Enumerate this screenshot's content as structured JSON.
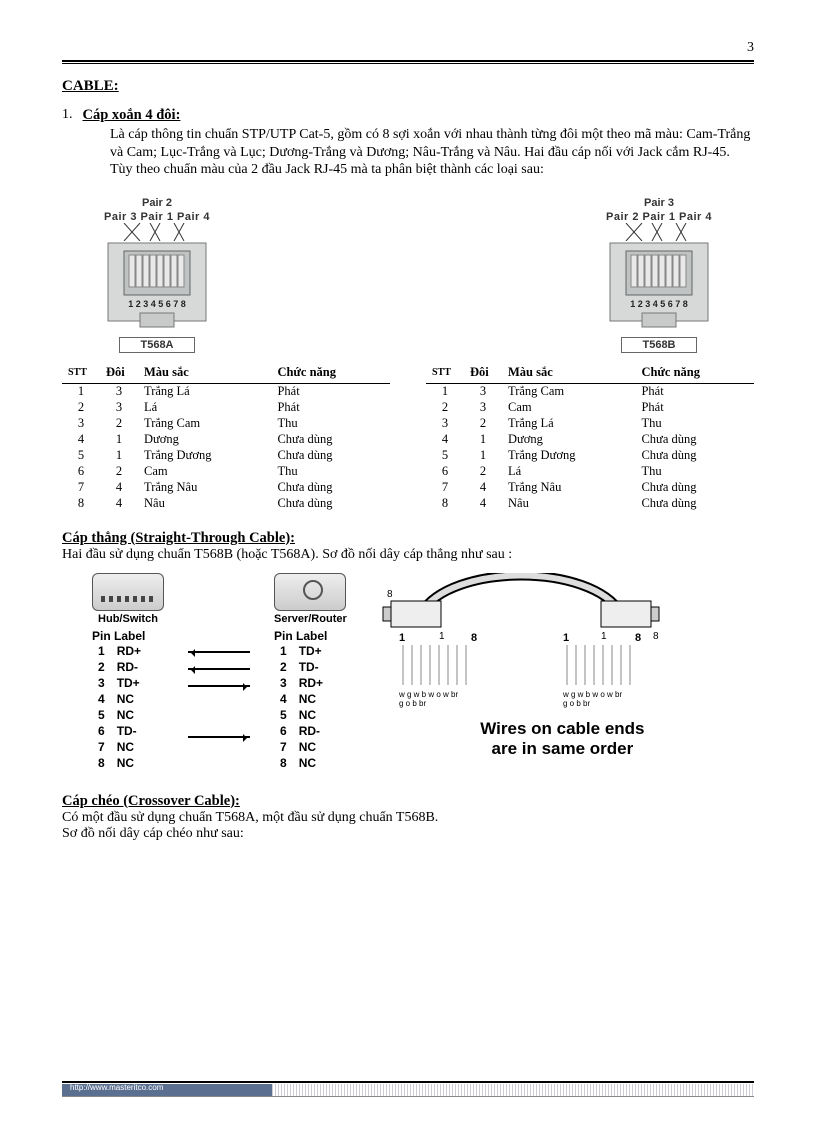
{
  "page_number": "3",
  "section_title": "CABLE:",
  "item1": {
    "num": "1.",
    "heading": "Cáp xoắn 4 đôi:",
    "para": "Là cáp thông tin chuẩn STP/UTP Cat-5, gồm có 8 sợi xoắn với nhau thành từng đôi một theo mã màu: Cam-Trắng và Cam; Lục-Trắng và Lục; Dương-Trắng và Dương; Nâu-Trắng và Nâu. Hai đầu cáp nối với Jack cắm RJ-45.\nTùy theo chuẩn màu của 2 đầu Jack RJ-45 mà ta phân biệt thành các loại sau:"
  },
  "jackA": {
    "top": "Pair 2",
    "mid": "Pair 3  Pair 1  Pair 4",
    "pins": "1 2 3 4 5 6 7 8",
    "label": "T568A"
  },
  "jackB": {
    "top": "Pair 3",
    "mid": "Pair 2  Pair 1  Pair 4",
    "pins": "1 2 3 4 5 6 7 8",
    "label": "T568B"
  },
  "tbl_headers": {
    "stt": "STT",
    "doi": "Đôi",
    "mau": "Màu sắc",
    "chuc": "Chức năng"
  },
  "left_rows": [
    {
      "stt": "1",
      "doi": "3",
      "mau": "Trắng Lá",
      "chuc": "Phát"
    },
    {
      "stt": "2",
      "doi": "3",
      "mau": "Lá",
      "chuc": "Phát"
    },
    {
      "stt": "3",
      "doi": "2",
      "mau": "Trắng Cam",
      "chuc": "Thu"
    },
    {
      "stt": "4",
      "doi": "1",
      "mau": "Dương",
      "chuc": "Chưa dùng"
    },
    {
      "stt": "5",
      "doi": "1",
      "mau": "Trắng Dương",
      "chuc": "Chưa dùng"
    },
    {
      "stt": "6",
      "doi": "2",
      "mau": "Cam",
      "chuc": "Thu"
    },
    {
      "stt": "7",
      "doi": "4",
      "mau": "Trắng Nâu",
      "chuc": "Chưa dùng"
    },
    {
      "stt": "8",
      "doi": "4",
      "mau": "Nâu",
      "chuc": "Chưa dùng"
    }
  ],
  "right_rows": [
    {
      "stt": "1",
      "doi": "3",
      "mau": "Trắng Cam",
      "chuc": "Phát"
    },
    {
      "stt": "2",
      "doi": "3",
      "mau": "Cam",
      "chuc": "Phát"
    },
    {
      "stt": "3",
      "doi": "2",
      "mau": "Trắng Lá",
      "chuc": "Thu"
    },
    {
      "stt": "4",
      "doi": "1",
      "mau": "Dương",
      "chuc": "Chưa dùng"
    },
    {
      "stt": "5",
      "doi": "1",
      "mau": "Trắng Dương",
      "chuc": "Chưa dùng"
    },
    {
      "stt": "6",
      "doi": "2",
      "mau": "Lá",
      "chuc": "Thu"
    },
    {
      "stt": "7",
      "doi": "4",
      "mau": "Trắng Nâu",
      "chuc": "Chưa dùng"
    },
    {
      "stt": "8",
      "doi": "4",
      "mau": "Nâu",
      "chuc": "Chưa dùng"
    }
  ],
  "straight": {
    "heading": "Cáp thẳng (Straight-Through Cable):",
    "desc": "Hai đầu sử dụng chuẩn T568B (hoặc T568A). Sơ đồ nối dây cáp thẳng như sau :"
  },
  "pins": {
    "left_dev": "Hub/Switch",
    "right_dev": "Server/Router",
    "hdr": "Pin  Label",
    "rows": [
      {
        "lp": "1",
        "ll": "RD+",
        "a": "l",
        "rp": "1",
        "rl": "TD+"
      },
      {
        "lp": "2",
        "ll": "RD-",
        "a": "l",
        "rp": "2",
        "rl": "TD-"
      },
      {
        "lp": "3",
        "ll": "TD+",
        "a": "r",
        "rp": "3",
        "rl": "RD+"
      },
      {
        "lp": "4",
        "ll": "NC",
        "a": "",
        "rp": "4",
        "rl": "NC"
      },
      {
        "lp": "5",
        "ll": "NC",
        "a": "",
        "rp": "5",
        "rl": "NC"
      },
      {
        "lp": "6",
        "ll": "TD-",
        "a": "r",
        "rp": "6",
        "rl": "RD-"
      },
      {
        "lp": "7",
        "ll": "NC",
        "a": "",
        "rp": "7",
        "rl": "NC"
      },
      {
        "lp": "8",
        "ll": "NC",
        "a": "",
        "rp": "8",
        "rl": "NC"
      }
    ]
  },
  "wire_diagram": {
    "num1": "1",
    "num8": "8",
    "codes_line1": "w g w b  w o w br",
    "codes_line2": "g      o      b     br",
    "caption1": "Wires on cable ends",
    "caption2": "are in same order"
  },
  "crossover": {
    "heading": "Cáp chéo (Crossover Cable):",
    "line1": "Có một đầu sử dụng chuẩn T568A, một đầu sử dụng chuẩn T568B.",
    "line2": "Sơ đồ nối dây cáp chéo như sau:"
  },
  "footer_url": "http://www.masteritco.com"
}
